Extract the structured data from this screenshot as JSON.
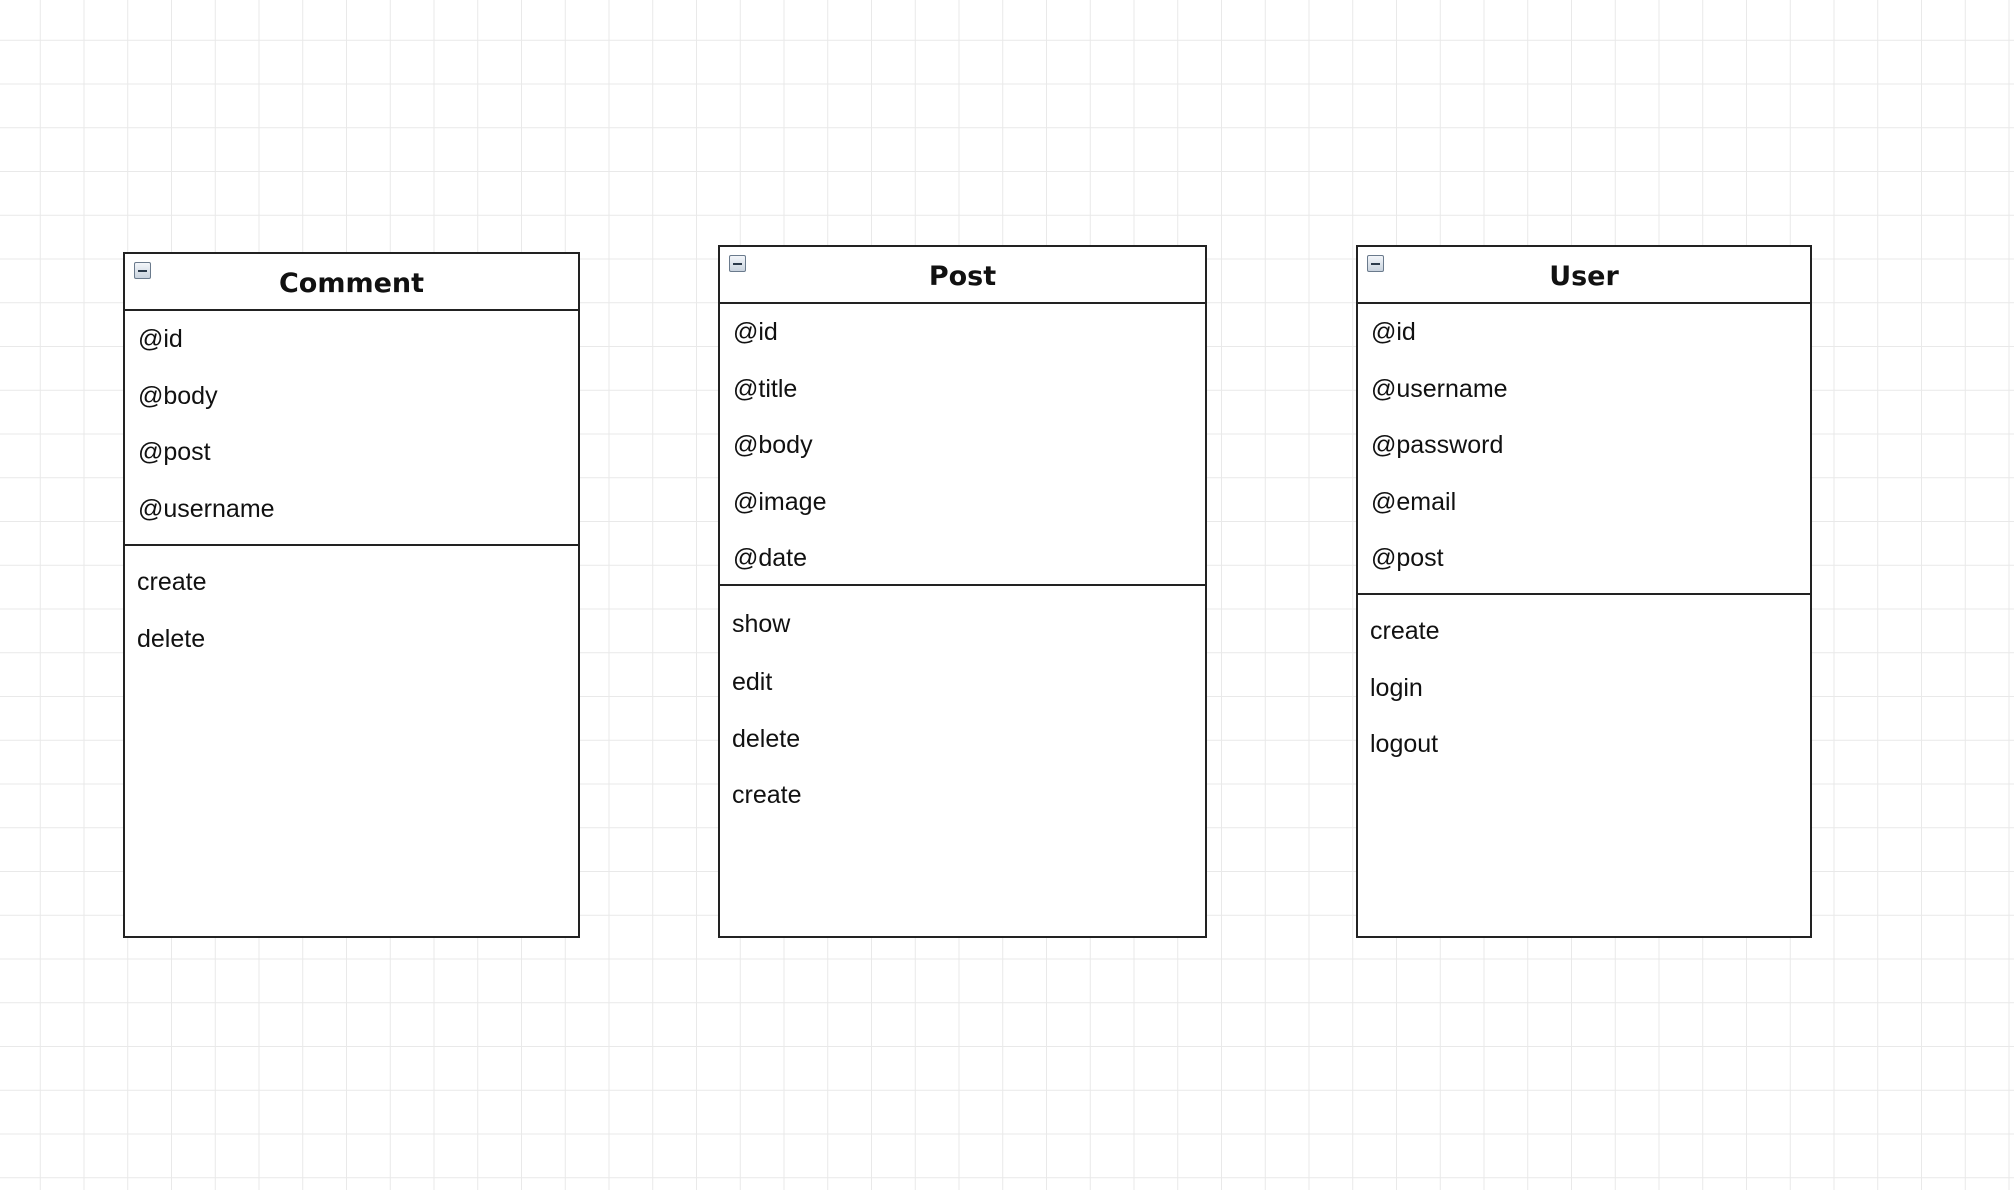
{
  "classes": [
    {
      "id": "comment",
      "title": "Comment",
      "attributes": [
        "@id",
        "@body",
        "@post",
        "@username"
      ],
      "operations": [
        "create",
        "delete"
      ]
    },
    {
      "id": "post",
      "title": "Post",
      "attributes": [
        "@id",
        "@title",
        "@body",
        "@image",
        "@date"
      ],
      "operations": [
        "show",
        "edit",
        "delete",
        "create"
      ]
    },
    {
      "id": "user",
      "title": "User",
      "attributes": [
        "@id",
        "@username",
        "@password",
        "@email",
        "@post"
      ],
      "operations": [
        "create",
        "login",
        "logout"
      ]
    }
  ]
}
